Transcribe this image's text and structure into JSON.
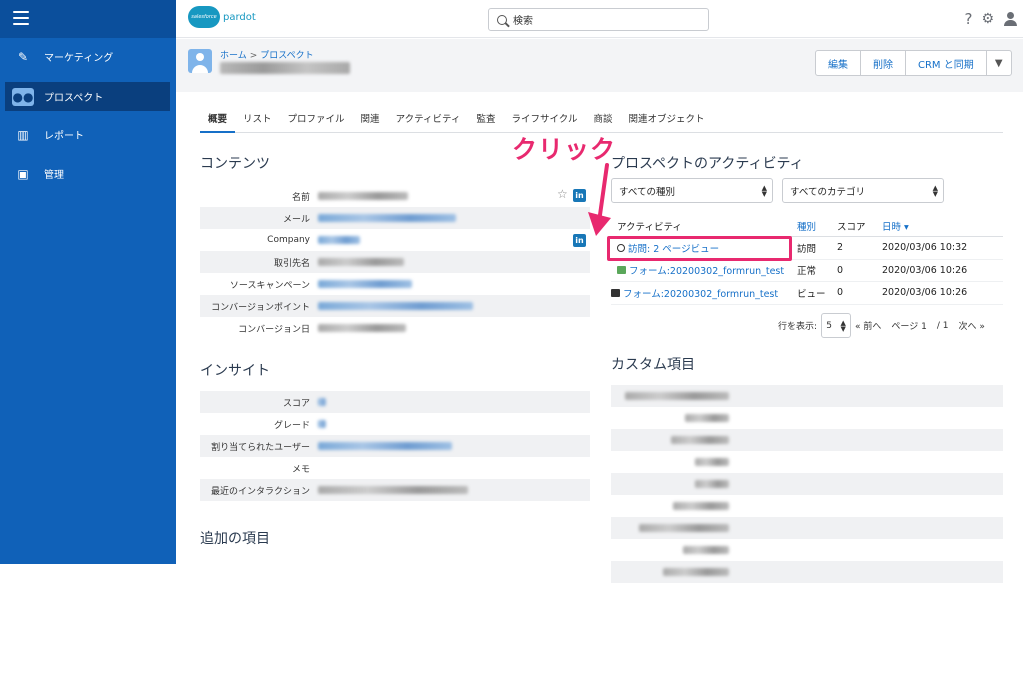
{
  "header": {
    "logo_cloud": "salesforce",
    "logo_word": "pardot",
    "search_placeholder": "検索",
    "help_icon": "?",
    "gear_icon": "⚙",
    "user_icon": "👤"
  },
  "sidebar": {
    "items": [
      {
        "label": "マーケティング",
        "icon": "magic-wand-icon"
      },
      {
        "label": "プロスペクト",
        "icon": "people-icon"
      },
      {
        "label": "レポート",
        "icon": "bar-chart-icon"
      },
      {
        "label": "管理",
        "icon": "briefcase-icon"
      }
    ]
  },
  "pagehead": {
    "crumb_home": "ホーム",
    "crumb_sep": ">",
    "crumb_current": "プロスペクト",
    "actions": [
      "編集",
      "削除",
      "CRM と同期"
    ]
  },
  "tabs": [
    "概要",
    "リスト",
    "プロファイル",
    "関連",
    "アクティビティ",
    "監査",
    "ライフサイクル",
    "商談",
    "関連オブジェクト"
  ],
  "content": {
    "title": "コンテンツ",
    "fields": [
      "名前",
      "メール",
      "Company",
      "取引先名",
      "ソースキャンペーン",
      "コンバージョンポイント",
      "コンバージョン日"
    ]
  },
  "insight": {
    "title": "インサイト",
    "fields": [
      "スコア",
      "グレード",
      "割り当てられたユーザー",
      "メモ",
      "最近のインタラクション"
    ]
  },
  "additional": {
    "title": "追加の項目"
  },
  "activity": {
    "title": "プロスペクトのアクティビティ",
    "filter_type": "すべての種別",
    "filter_category": "すべてのカテゴリ",
    "columns": [
      "アクティビティ",
      "種別",
      "スコア",
      "日時"
    ],
    "sort_indicator": "▾",
    "rows": [
      {
        "activity": "訪問: 2 ページビュー",
        "type": "訪問",
        "score": "2",
        "date": "2020/03/06 10:32"
      },
      {
        "activity": "フォーム:20200302_formrun_test",
        "type": "正常",
        "score": "0",
        "date": "2020/03/06 10:26"
      },
      {
        "activity": "フォーム:20200302_formrun_test",
        "type": "ビュー",
        "score": "0",
        "date": "2020/03/06 10:26"
      }
    ],
    "pager": {
      "rows_label": "行を表示:",
      "rows_value": "5",
      "prev": "« 前へ",
      "page_label": "ページ 1",
      "of_label": "/ 1",
      "next": "次へ »"
    }
  },
  "custom": {
    "title": "カスタム項目"
  },
  "annotation": {
    "text": "クリック",
    "color": "#e8296f"
  },
  "colors": {
    "sidebar": "#1061b8",
    "link": "#1670c8",
    "accent": "#e8296f"
  }
}
